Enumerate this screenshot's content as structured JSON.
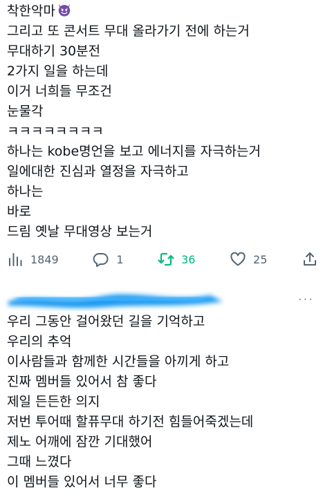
{
  "tweet1": {
    "lines": [
      "착한악마",
      "그리고 또 콘서트 무대 올라가기 전에 하는거",
      "무대하기 30분전",
      "2가지 일을 하는데",
      "이거 너희들 무조건",
      "눈물각",
      "ㅋㅋㅋㅋㅋㅋㅋㅋ",
      "하나는 kobe명언을 보고 에너지를 자극하는거",
      "일에대한 진심과 열정을 자극하고",
      "하나는",
      "바로",
      "드림 옛날 무대영상 보는거"
    ],
    "emoji": "smiling-devil-emoji"
  },
  "actions": {
    "views": "1849",
    "replies": "1",
    "retweets": "36",
    "likes": "25",
    "retweet_color": "#00ba7c",
    "icon_color": "#536471"
  },
  "tweet2": {
    "lines": [
      "우리 그동안 걸어왔던 길을 기억하고",
      "우리의 추억",
      "이사람들과 함께한 시간들을 아끼게 하고",
      "진짜 멤버들 있어서 참 좋다",
      "제일 든든한 의지",
      "저번 투어때 할퓨무대 하기전 힘들어죽겠는데",
      "제노 어깨에 잠깐 기대했어",
      "그때 느꼈다",
      "이 멤버들 있어서 너무 좋다"
    ]
  },
  "more_menu": "···",
  "blur_color": "#1d9bf0"
}
